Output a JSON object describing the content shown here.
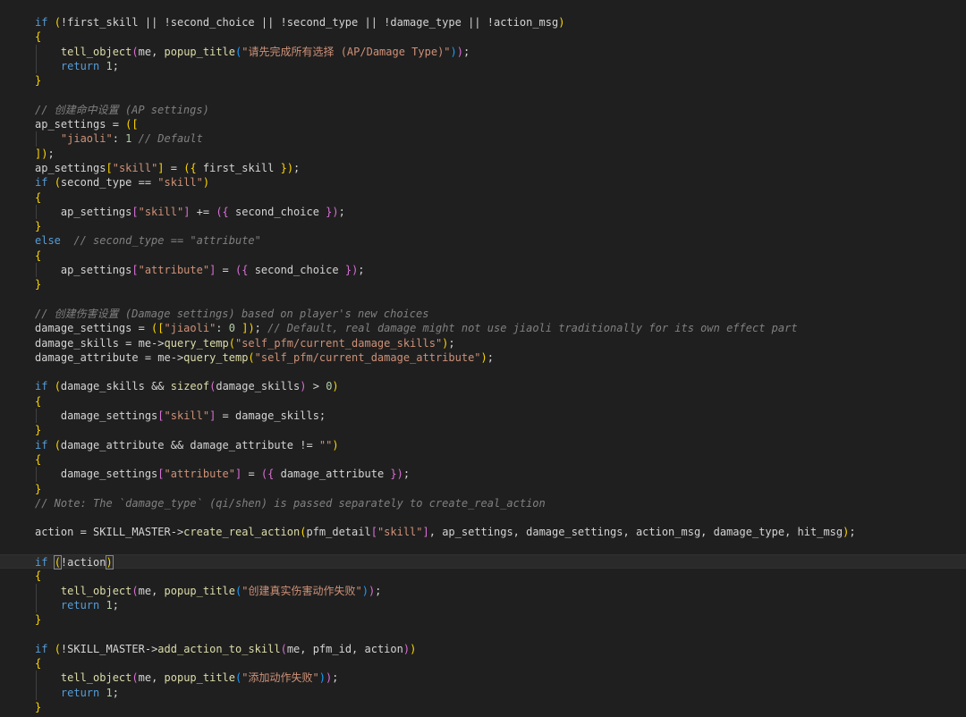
{
  "editor": {
    "language": "lpc",
    "background_color": "#1f1f1f",
    "current_line_index": 37,
    "lines": [
      [
        [
          "kw",
          "if "
        ],
        [
          "brk1",
          "("
        ],
        [
          "var",
          "!first_skill || !second_choice || !second_type || !damage_type || !action_msg"
        ],
        [
          "brk1",
          ")"
        ]
      ],
      [
        [
          "brk1",
          "{"
        ]
      ],
      [
        [
          "var",
          "    "
        ],
        [
          "fn",
          "tell_object"
        ],
        [
          "brk2",
          "("
        ],
        [
          "var",
          "me, "
        ],
        [
          "fn",
          "popup_title"
        ],
        [
          "brk3",
          "("
        ],
        [
          "str",
          "\"请先完成所有选择 (AP/Damage Type)\""
        ],
        [
          "brk3",
          ")"
        ],
        [
          "brk2",
          ")"
        ],
        [
          "var",
          ";"
        ]
      ],
      [
        [
          "var",
          "    "
        ],
        [
          "kw",
          "return "
        ],
        [
          "num",
          "1"
        ],
        [
          "var",
          ";"
        ]
      ],
      [
        [
          "brk1",
          "}"
        ]
      ],
      [],
      [
        [
          "cmt2",
          "// 创建命中设置 (AP settings)"
        ]
      ],
      [
        [
          "var",
          "ap_settings = "
        ],
        [
          "brk1",
          "(["
        ]
      ],
      [
        [
          "var",
          "    "
        ],
        [
          "str",
          "\"jiaoli\""
        ],
        [
          "var",
          ": "
        ],
        [
          "num",
          "1"
        ],
        [
          "var",
          " "
        ],
        [
          "cmt2",
          "// Default"
        ]
      ],
      [
        [
          "brk1",
          "])"
        ],
        [
          "var",
          ";"
        ]
      ],
      [
        [
          "var",
          "ap_settings"
        ],
        [
          "brk1",
          "["
        ],
        [
          "str",
          "\"skill\""
        ],
        [
          "brk1",
          "]"
        ],
        [
          "var",
          " = "
        ],
        [
          "brk1",
          "({"
        ],
        [
          "var",
          " first_skill "
        ],
        [
          "brk1",
          "})"
        ],
        [
          "var",
          ";"
        ]
      ],
      [
        [
          "kw",
          "if "
        ],
        [
          "brk1",
          "("
        ],
        [
          "var",
          "second_type == "
        ],
        [
          "str",
          "\"skill\""
        ],
        [
          "brk1",
          ")"
        ]
      ],
      [
        [
          "brk1",
          "{"
        ]
      ],
      [
        [
          "var",
          "    ap_settings"
        ],
        [
          "brk2",
          "["
        ],
        [
          "str",
          "\"skill\""
        ],
        [
          "brk2",
          "]"
        ],
        [
          "var",
          " += "
        ],
        [
          "brk2",
          "({"
        ],
        [
          "var",
          " second_choice "
        ],
        [
          "brk2",
          "})"
        ],
        [
          "var",
          ";"
        ]
      ],
      [
        [
          "brk1",
          "}"
        ]
      ],
      [
        [
          "kw",
          "else  "
        ],
        [
          "cmt2",
          "// second_type == \"attribute\""
        ]
      ],
      [
        [
          "brk1",
          "{"
        ]
      ],
      [
        [
          "var",
          "    ap_settings"
        ],
        [
          "brk2",
          "["
        ],
        [
          "str",
          "\"attribute\""
        ],
        [
          "brk2",
          "]"
        ],
        [
          "var",
          " = "
        ],
        [
          "brk2",
          "({"
        ],
        [
          "var",
          " second_choice "
        ],
        [
          "brk2",
          "})"
        ],
        [
          "var",
          ";"
        ]
      ],
      [
        [
          "brk1",
          "}"
        ]
      ],
      [],
      [
        [
          "cmt2",
          "// 创建伤害设置 (Damage settings) based on player's new choices"
        ]
      ],
      [
        [
          "var",
          "damage_settings = "
        ],
        [
          "brk1",
          "(["
        ],
        [
          "str",
          "\"jiaoli\""
        ],
        [
          "var",
          ": "
        ],
        [
          "num",
          "0"
        ],
        [
          "var",
          " "
        ],
        [
          "brk1",
          "])"
        ],
        [
          "var",
          "; "
        ],
        [
          "cmt2",
          "// Default, real damage might not use jiaoli traditionally for its own effect part"
        ]
      ],
      [
        [
          "var",
          "damage_skills = me->"
        ],
        [
          "fn",
          "query_temp"
        ],
        [
          "brk1",
          "("
        ],
        [
          "str",
          "\"self_pfm/current_damage_skills\""
        ],
        [
          "brk1",
          ")"
        ],
        [
          "var",
          ";"
        ]
      ],
      [
        [
          "var",
          "damage_attribute = me->"
        ],
        [
          "fn",
          "query_temp"
        ],
        [
          "brk1",
          "("
        ],
        [
          "str",
          "\"self_pfm/current_damage_attribute\""
        ],
        [
          "brk1",
          ")"
        ],
        [
          "var",
          ";"
        ]
      ],
      [],
      [
        [
          "kw",
          "if "
        ],
        [
          "brk1",
          "("
        ],
        [
          "var",
          "damage_skills && "
        ],
        [
          "fn",
          "sizeof"
        ],
        [
          "brk2",
          "("
        ],
        [
          "var",
          "damage_skills"
        ],
        [
          "brk2",
          ")"
        ],
        [
          "var",
          " > "
        ],
        [
          "num",
          "0"
        ],
        [
          "brk1",
          ")"
        ]
      ],
      [
        [
          "brk1",
          "{"
        ]
      ],
      [
        [
          "var",
          "    damage_settings"
        ],
        [
          "brk2",
          "["
        ],
        [
          "str",
          "\"skill\""
        ],
        [
          "brk2",
          "]"
        ],
        [
          "var",
          " = damage_skills;"
        ]
      ],
      [
        [
          "brk1",
          "}"
        ]
      ],
      [
        [
          "kw",
          "if "
        ],
        [
          "brk1",
          "("
        ],
        [
          "var",
          "damage_attribute && damage_attribute != "
        ],
        [
          "str",
          "\"\""
        ],
        [
          "brk1",
          ")"
        ]
      ],
      [
        [
          "brk1",
          "{"
        ]
      ],
      [
        [
          "var",
          "    damage_settings"
        ],
        [
          "brk2",
          "["
        ],
        [
          "str",
          "\"attribute\""
        ],
        [
          "brk2",
          "]"
        ],
        [
          "var",
          " = "
        ],
        [
          "brk2",
          "({"
        ],
        [
          "var",
          " damage_attribute "
        ],
        [
          "brk2",
          "})"
        ],
        [
          "var",
          ";"
        ]
      ],
      [
        [
          "brk1",
          "}"
        ]
      ],
      [
        [
          "cmt2",
          "// Note: The `damage_type` (qi/shen) is passed separately to create_real_action"
        ]
      ],
      [],
      [
        [
          "var",
          "action = SKILL_MASTER->"
        ],
        [
          "fn",
          "create_real_action"
        ],
        [
          "brk1",
          "("
        ],
        [
          "var",
          "pfm_detail"
        ],
        [
          "brk2",
          "["
        ],
        [
          "str",
          "\"skill\""
        ],
        [
          "brk2",
          "]"
        ],
        [
          "var",
          ", ap_settings, damage_settings, action_msg, damage_type, hit_msg"
        ],
        [
          "brk1",
          ")"
        ],
        [
          "var",
          ";"
        ]
      ],
      [],
      [
        [
          "kw",
          "if "
        ],
        [
          "brk1",
          "("
        ],
        [
          "var",
          "!action"
        ],
        [
          "brk1",
          ")"
        ]
      ],
      [
        [
          "brk1",
          "{"
        ]
      ],
      [
        [
          "var",
          "    "
        ],
        [
          "fn",
          "tell_object"
        ],
        [
          "brk2",
          "("
        ],
        [
          "var",
          "me, "
        ],
        [
          "fn",
          "popup_title"
        ],
        [
          "brk3",
          "("
        ],
        [
          "str",
          "\"创建真实伤害动作失败\""
        ],
        [
          "brk3",
          ")"
        ],
        [
          "brk2",
          ")"
        ],
        [
          "var",
          ";"
        ]
      ],
      [
        [
          "var",
          "    "
        ],
        [
          "kw",
          "return "
        ],
        [
          "num",
          "1"
        ],
        [
          "var",
          ";"
        ]
      ],
      [
        [
          "brk1",
          "}"
        ]
      ],
      [],
      [
        [
          "kw",
          "if "
        ],
        [
          "brk1",
          "("
        ],
        [
          "var",
          "!SKILL_MASTER->"
        ],
        [
          "fn",
          "add_action_to_skill"
        ],
        [
          "brk2",
          "("
        ],
        [
          "var",
          "me, pfm_id, action"
        ],
        [
          "brk2",
          ")"
        ],
        [
          "brk1",
          ")"
        ]
      ],
      [
        [
          "brk1",
          "{"
        ]
      ],
      [
        [
          "var",
          "    "
        ],
        [
          "fn",
          "tell_object"
        ],
        [
          "brk2",
          "("
        ],
        [
          "var",
          "me, "
        ],
        [
          "fn",
          "popup_title"
        ],
        [
          "brk3",
          "("
        ],
        [
          "str",
          "\"添加动作失败\""
        ],
        [
          "brk3",
          ")"
        ],
        [
          "brk2",
          ")"
        ],
        [
          "var",
          ";"
        ]
      ],
      [
        [
          "var",
          "    "
        ],
        [
          "kw",
          "return "
        ],
        [
          "num",
          "1"
        ],
        [
          "var",
          ";"
        ]
      ],
      [
        [
          "brk1",
          "}"
        ]
      ]
    ]
  }
}
